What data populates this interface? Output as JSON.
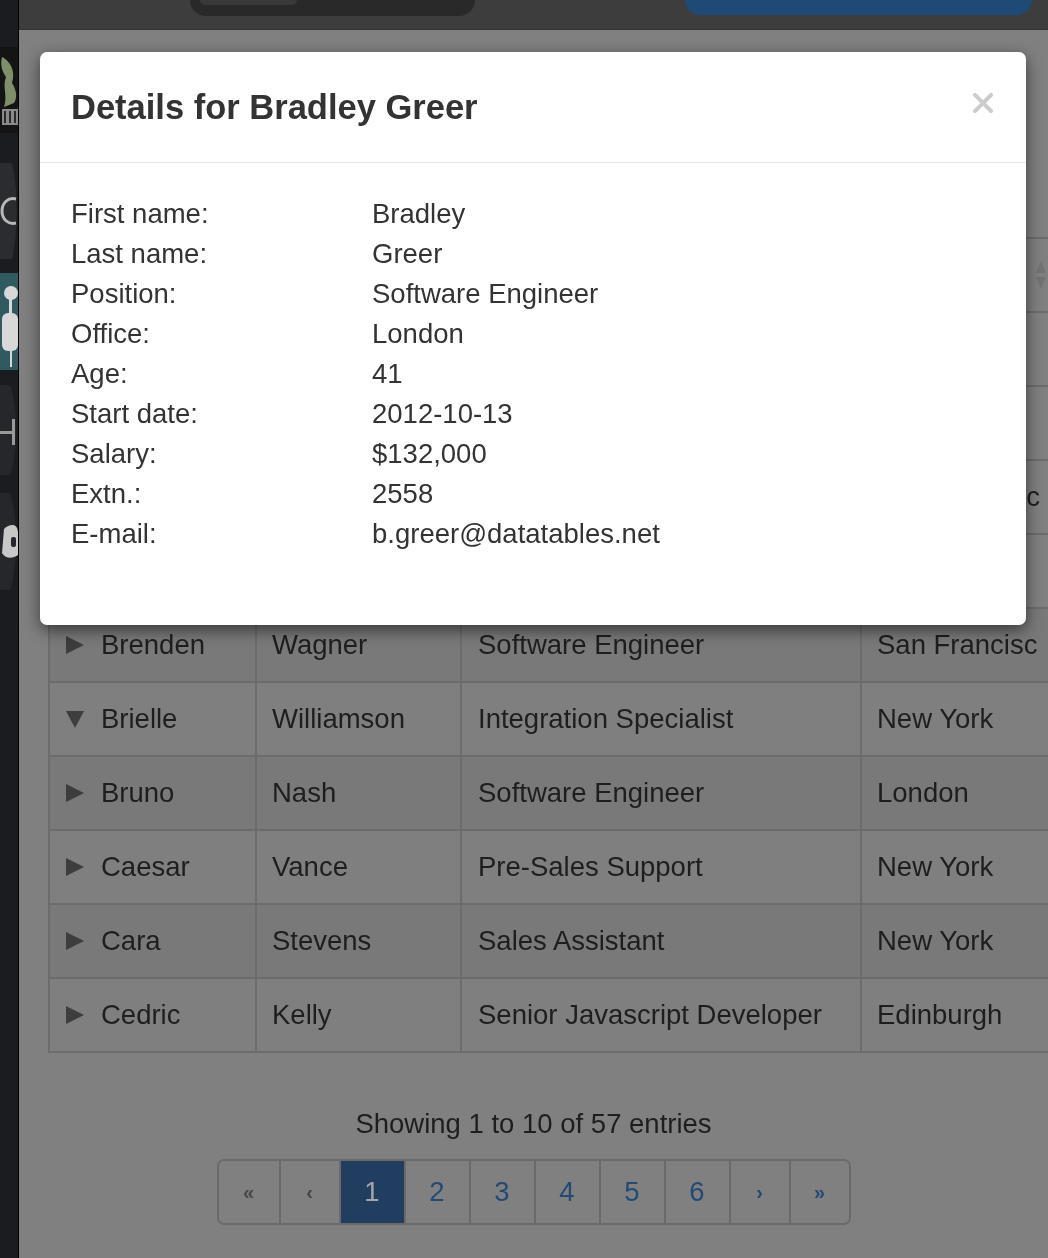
{
  "modal": {
    "title": "Details for Bradley Greer",
    "fields": [
      {
        "label": "First name:",
        "value": "Bradley"
      },
      {
        "label": "Last name:",
        "value": "Greer"
      },
      {
        "label": "Position:",
        "value": "Software Engineer"
      },
      {
        "label": "Office:",
        "value": "London"
      },
      {
        "label": "Age:",
        "value": "41"
      },
      {
        "label": "Start date:",
        "value": "2012-10-13"
      },
      {
        "label": "Salary:",
        "value": "$132,000"
      },
      {
        "label": "Extn.:",
        "value": "2558"
      },
      {
        "label": "E-mail:",
        "value": "b.greer@datatables.net"
      }
    ]
  },
  "table": {
    "covered_text": "c",
    "rows": [
      {
        "expanded": false,
        "first_name": "Brenden",
        "last_name": "Wagner",
        "position": "Software Engineer",
        "office": "San Francisc"
      },
      {
        "expanded": true,
        "first_name": "Brielle",
        "last_name": "Williamson",
        "position": "Integration Specialist",
        "office": "New York"
      },
      {
        "expanded": false,
        "first_name": "Bruno",
        "last_name": "Nash",
        "position": "Software Engineer",
        "office": "London"
      },
      {
        "expanded": false,
        "first_name": "Caesar",
        "last_name": "Vance",
        "position": "Pre-Sales Support",
        "office": "New York"
      },
      {
        "expanded": false,
        "first_name": "Cara",
        "last_name": "Stevens",
        "position": "Sales Assistant",
        "office": "New York"
      },
      {
        "expanded": false,
        "first_name": "Cedric",
        "last_name": "Kelly",
        "position": "Senior Javascript Developer",
        "office": "Edinburgh"
      }
    ]
  },
  "info": "Showing 1 to 10 of 57 entries",
  "pagination": [
    {
      "label": "«",
      "kind": "arrow",
      "selected": false,
      "disabled": true
    },
    {
      "label": "‹",
      "kind": "arrow",
      "selected": false,
      "disabled": true
    },
    {
      "label": "1",
      "kind": "page",
      "selected": true,
      "disabled": false
    },
    {
      "label": "2",
      "kind": "page",
      "selected": false,
      "disabled": false
    },
    {
      "label": "3",
      "kind": "page",
      "selected": false,
      "disabled": false
    },
    {
      "label": "4",
      "kind": "page",
      "selected": false,
      "disabled": false
    },
    {
      "label": "5",
      "kind": "page",
      "selected": false,
      "disabled": false
    },
    {
      "label": "6",
      "kind": "page",
      "selected": false,
      "disabled": false
    },
    {
      "label": "›",
      "kind": "arrow",
      "selected": false,
      "disabled": false
    },
    {
      "label": "»",
      "kind": "arrow",
      "selected": false,
      "disabled": false
    }
  ]
}
